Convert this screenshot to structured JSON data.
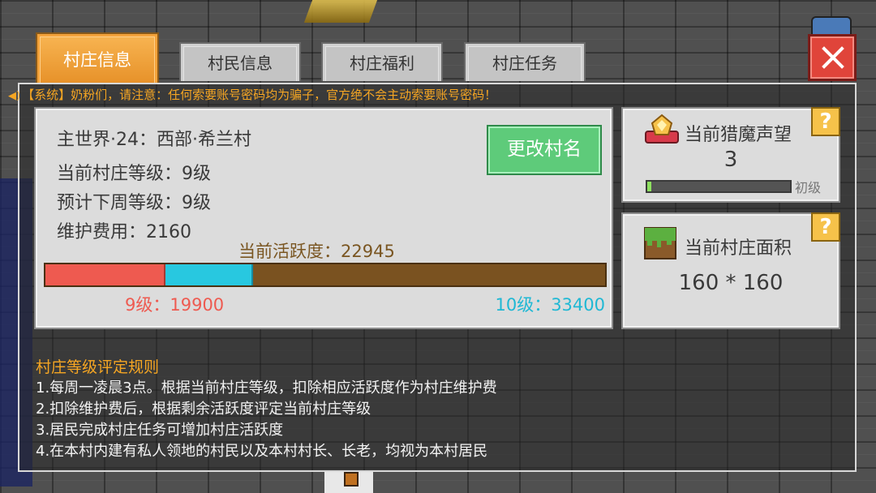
{
  "tabs": [
    {
      "label": "村庄信息",
      "active": true
    },
    {
      "label": "村民信息",
      "active": false
    },
    {
      "label": "村庄福利",
      "active": false
    },
    {
      "label": "村庄任务",
      "active": false
    }
  ],
  "notice": "【系统】奶粉们，请注意：任何索要账号密码均为骗子，官方绝不会主动索要账号密码！",
  "village": {
    "location": "主世界·24：西部·希兰村",
    "current_level": "当前村庄等级：9级",
    "next_week_level": "预计下周等级：9级",
    "maintenance": "维护费用：2160",
    "rename_label": "更改村名",
    "activity_label": "当前活跃度：22945",
    "activity": {
      "current": 22945,
      "maintenance": 2160,
      "level_low_threshold": 19900,
      "level_high_threshold": 33400
    },
    "level_low_label": "9级：19900",
    "level_high_label": "10级：33400"
  },
  "reputation": {
    "title": "当前猎魔声望",
    "value": "3",
    "tier": "初级",
    "progress": 0.02
  },
  "area": {
    "title": "当前村庄面积",
    "value": "160 * 160"
  },
  "help_label": "?",
  "rules": {
    "title": "村庄等级评定规则",
    "items": [
      "1.每周一凌晨3点。根据当前村庄等级，扣除相应活跃度作为村庄维护费",
      "2.扣除维护费后，根据剩余活跃度评定当前村庄等级",
      "3.居民完成村庄任务可增加村庄活跃度",
      "4.在本村内建有私人领地的村民以及本村村长、长老，均视为本村居民"
    ]
  },
  "colors": {
    "accent_orange": "#f3a23a",
    "rename_green": "#5ecb7a",
    "bar_red": "#ee5a50",
    "bar_cyan": "#28c8e0",
    "bar_brown": "#7a5220",
    "close_red": "#e0443a"
  }
}
